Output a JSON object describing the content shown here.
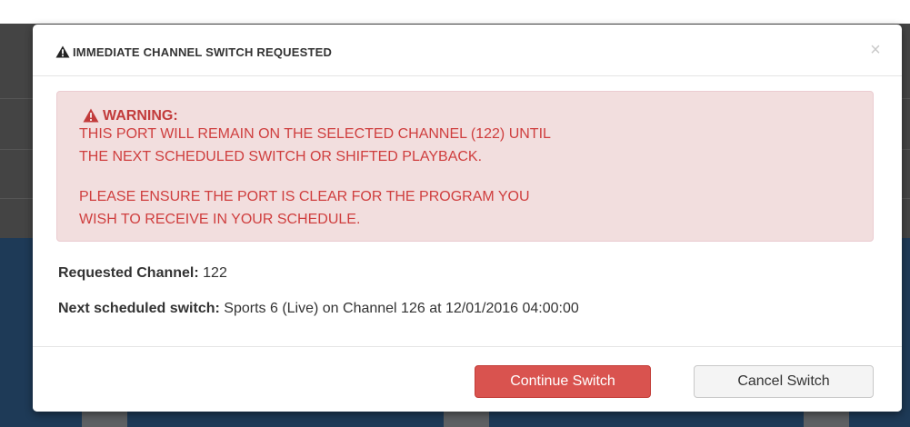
{
  "modal": {
    "title": "IMMEDIATE CHANNEL SWITCH REQUESTED",
    "close_label": "×",
    "alert": {
      "heading": "WARNING:",
      "lines": [
        "THIS PORT WILL REMAIN ON THE SELECTED CHANNEL (122) UNTIL",
        "THE NEXT SCHEDULED SWITCH OR SHIFTED PLAYBACK.",
        "PLEASE ENSURE THE PORT IS CLEAR FOR THE PROGRAM YOU",
        "WISH TO RECEIVE IN YOUR SCHEDULE."
      ]
    },
    "requested_channel": {
      "label": "Requested Channel:",
      "value": "122"
    },
    "next_switch": {
      "label": "Next scheduled switch:",
      "value": "Sports 6 (Live) on Channel 126 at 12/01/2016 04:00:00"
    },
    "buttons": {
      "continue_label": "Continue Switch",
      "cancel_label": "Cancel Switch"
    }
  },
  "colors": {
    "danger_button": "#d9534f",
    "alert_background": "#f2dede",
    "alert_text": "#cf3e3e",
    "overlay_dark": "#444444",
    "overlay_blue": "#1e3a57"
  }
}
